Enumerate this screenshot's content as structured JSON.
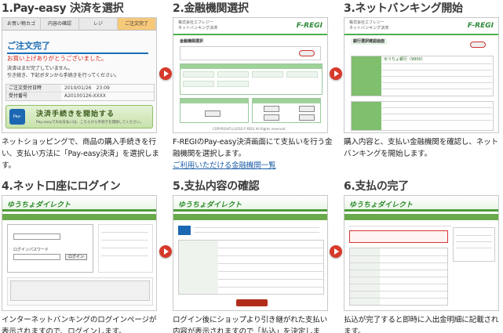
{
  "steps": [
    {
      "title": "1.Pay-easy 決済を選択",
      "desc": "ネットショッピングで、商品の購入手続きを行い、支払い方法に「Pay-easy決済」を選択します。"
    },
    {
      "title": "2.金融機関選択",
      "desc": "F-REGIのPay-easy決済画面にて支払いを行う金融機関を選択します。",
      "link": "ご利用いただける金融機関一覧"
    },
    {
      "title": "3.ネットバンキング開始",
      "desc": "購入内容と、支払い金融機関を確認し、ネットバンキングを開始します。"
    },
    {
      "title": "4.ネット口座にログイン",
      "desc": "インターネットバンキングのログインページが表示されますので、ログインします。"
    },
    {
      "title": "5.支払内容の確認",
      "desc": "ログイン後にショップより引き継がれた支払い内容が表示されますので「払込」を決定します。"
    },
    {
      "title": "6.支払の完了",
      "desc": "払込が完了すると即時に入出金明細に記載されます。"
    }
  ],
  "shot1": {
    "tabs": [
      "お買い物カゴ",
      "内容の確認",
      "レジ",
      "ご注文完了"
    ],
    "heading": "ご注文完了",
    "thanks": "お買い上げありがとうございました。",
    "note": "決済はまだ完了していません。\n引き続き、下記ボタンから手続きを行ってください。",
    "rows": [
      {
        "label": "ご注文受付日時",
        "value": "2010/01/26　23:09"
      },
      {
        "label": "受付番号",
        "value": "A20100126-XXXX"
      }
    ],
    "logo": "Pay-easy",
    "button": "決済手続きを開始する",
    "button_sub": "Pay-easyでのお支払いは、こちらから手続きを開始してください。"
  },
  "shot2": {
    "company": "株式会社エフレジー",
    "screen": "ネットバンキング決済",
    "brand": "F-REGI",
    "section": "金融機関選択",
    "footer": "COPYRIGHT(c)2010 F-REGI All Rights reserved."
  },
  "shot3": {
    "company": "株式会社エフレジー",
    "screen": "ネットバンキング決済",
    "brand": "F-REGI",
    "section": "銀行選択確認画面",
    "bank": "ゆうちょ銀行（9900）"
  },
  "shot4": {
    "brand": "ゆうちょダイレクト",
    "login_label": "ログインパスワード",
    "login_button": "ログイン"
  },
  "shot5": {
    "brand": "ゆうちょダイレクト"
  },
  "shot6": {
    "brand": "ゆうちょダイレクト"
  },
  "colors": {
    "arrow": "#d63a2b",
    "link": "#1f5fa8",
    "brand_green": "#2e8b3a"
  }
}
